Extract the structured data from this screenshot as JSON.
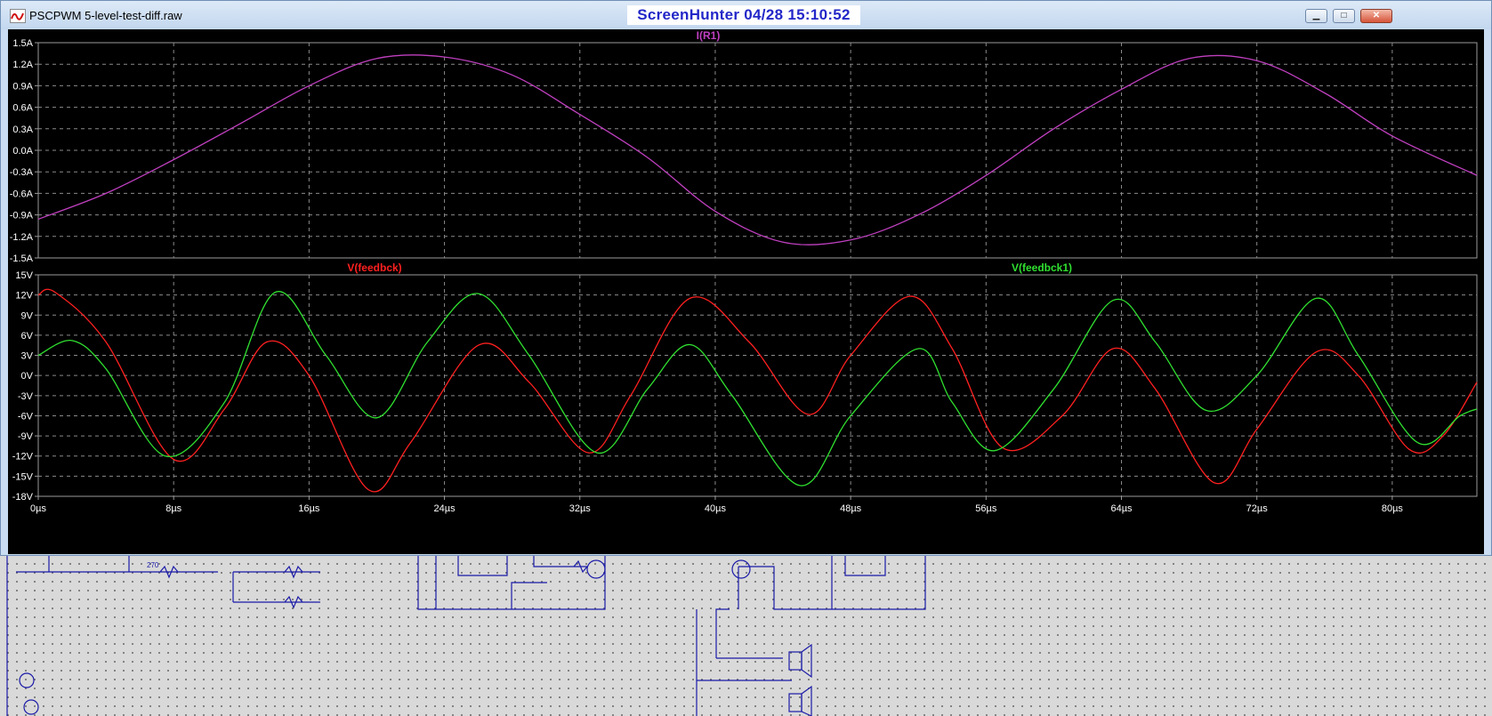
{
  "window": {
    "title": "PSCPWM 5-level-test-diff.raw",
    "overlay_text": "ScreenHunter  04/28  15:10:52",
    "controls": {
      "minimize": "▁",
      "maximize": "□",
      "close": "✕"
    }
  },
  "colors": {
    "plot_background": "#000000",
    "current_trace": "#c040c0",
    "feedbck_trace": "#ff2020",
    "feedbck1_trace": "#30e030",
    "axis_text": "#ffffff",
    "grid": "#8a8a8a",
    "schematic_background": "#d9d9d9",
    "schematic_wire": "#1a1aa8"
  },
  "chart_data": [
    {
      "type": "line",
      "title": "I(R1)",
      "xlabel": "",
      "ylabel": "",
      "xlim": [
        0,
        85
      ],
      "ylim": [
        -1.5,
        1.5
      ],
      "grid": true,
      "x_ticks": [
        0,
        8,
        16,
        24,
        32,
        40,
        48,
        56,
        64,
        72,
        80
      ],
      "y_ticks": [
        1.5,
        1.2,
        0.9,
        0.6,
        0.3,
        0.0,
        -0.3,
        -0.6,
        -0.9,
        -1.2,
        -1.5
      ],
      "y_tick_labels": [
        "1.5A",
        "1.2A",
        "0.9A",
        "0.6A",
        "0.3A",
        "0.0A",
        "-0.3A",
        "-0.6A",
        "-0.9A",
        "-1.2A",
        "-1.5A"
      ],
      "series": [
        {
          "name": "I(R1)",
          "x": [
            0,
            4,
            8,
            12,
            16,
            20,
            24,
            28,
            32,
            36,
            40,
            44,
            48,
            52,
            56,
            60,
            64,
            68,
            72,
            76,
            80,
            85
          ],
          "y": [
            -0.96,
            -0.6,
            -0.13,
            0.38,
            0.9,
            1.28,
            1.3,
            1.05,
            0.5,
            -0.1,
            -0.85,
            -1.28,
            -1.25,
            -0.9,
            -0.35,
            0.3,
            0.85,
            1.28,
            1.25,
            0.8,
            0.2,
            -0.35
          ]
        }
      ]
    },
    {
      "type": "line",
      "title": "",
      "xlabel": "",
      "ylabel": "",
      "xlim": [
        0,
        85
      ],
      "ylim": [
        -18,
        15
      ],
      "grid": true,
      "x_ticks": [
        0,
        8,
        16,
        24,
        32,
        40,
        48,
        56,
        64,
        72,
        80
      ],
      "x_tick_labels": [
        "0µs",
        "8µs",
        "16µs",
        "24µs",
        "32µs",
        "40µs",
        "48µs",
        "56µs",
        "64µs",
        "72µs",
        "80µs"
      ],
      "y_ticks": [
        15,
        12,
        9,
        6,
        3,
        0,
        -3,
        -6,
        -9,
        -12,
        -15,
        -18
      ],
      "y_tick_labels": [
        "15V",
        "12V",
        "9V",
        "6V",
        "3V",
        "0V",
        "-3V",
        "-6V",
        "-9V",
        "-12V",
        "-15V",
        "-18V"
      ],
      "series": [
        {
          "name": "V(feedbck)",
          "x": [
            0,
            1,
            4,
            8,
            11,
            13.5,
            16,
            19.5,
            22,
            26,
            29,
            32.5,
            35,
            38.5,
            42,
            45.5,
            48,
            51.5,
            54,
            57,
            60.5,
            63.5,
            66,
            69.5,
            72,
            75.5,
            78,
            81,
            83,
            85
          ],
          "y": [
            12,
            12.4,
            5,
            -12.5,
            -5,
            5,
            0,
            -17,
            -10,
            4.5,
            -1,
            -11.5,
            -3,
            11.5,
            5,
            -5.8,
            3,
            11.8,
            4,
            -10.8,
            -6,
            4,
            -2,
            -16,
            -8,
            3.5,
            0,
            -11,
            -9,
            -1
          ]
        },
        {
          "name": "V(feedbck1)",
          "x": [
            0,
            2,
            4,
            7.5,
            11,
            14,
            17,
            20,
            23,
            26,
            29,
            33,
            36,
            38.5,
            41,
            45,
            48,
            52,
            54,
            56.5,
            60,
            63.5,
            66,
            69,
            72,
            75.5,
            78,
            81.5,
            84,
            85
          ],
          "y": [
            3,
            5.2,
            1,
            -12,
            -4,
            12.4,
            3,
            -6.3,
            5,
            12.2,
            3,
            -11.5,
            -2,
            4.6,
            -3,
            -16.4,
            -6,
            4,
            -4,
            -11.2,
            -2,
            11.2,
            5,
            -5.2,
            0,
            11.5,
            3,
            -10,
            -6,
            -5
          ]
        }
      ],
      "legend": [
        "V(feedbck)",
        "V(feedbck1)"
      ],
      "legend_placement": "top"
    }
  ],
  "schematic": {
    "visible_label": "270"
  }
}
